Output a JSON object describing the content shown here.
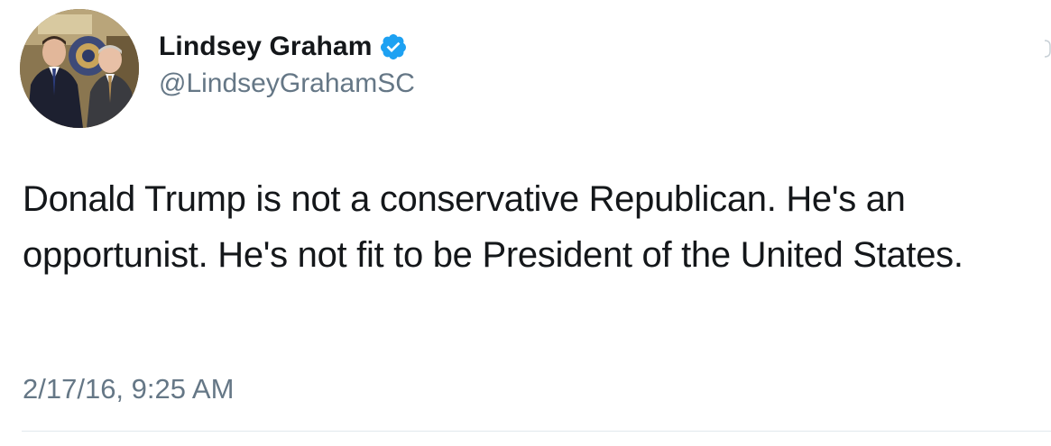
{
  "tweet": {
    "author": {
      "display_name": "Lindsey Graham",
      "handle": "@LindseyGrahamSC",
      "verified": true,
      "verified_icon": "verified-badge-icon",
      "verified_color": "#1da1f2"
    },
    "text": "Donald Trump is not a conservative Republican. He's an opportunist. He's not fit to be President of the United States.",
    "timestamp": "2/17/16, 9:25 AM"
  },
  "colors": {
    "text_primary": "#14171a",
    "text_secondary": "#657786",
    "divider": "#e1e8ed"
  }
}
